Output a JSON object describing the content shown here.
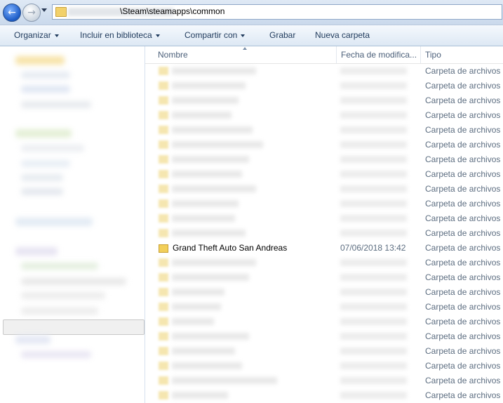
{
  "address": {
    "path": "\\Steam\\steamapps\\common",
    "back_icon": "arrow-left-icon",
    "forward_icon": "arrow-right-icon",
    "folder_icon": "folder-icon"
  },
  "toolbar": {
    "organize": "Organizar",
    "include_library": "Incluir en biblioteca",
    "share_with": "Compartir con",
    "burn": "Grabar",
    "new_folder": "Nueva carpeta"
  },
  "columns": {
    "name": "Nombre",
    "date": "Fecha de modifica...",
    "type": "Tipo"
  },
  "rows": [
    {
      "name": "",
      "date": "",
      "type": "Carpeta de archivos"
    },
    {
      "name": "",
      "date": "",
      "type": "Carpeta de archivos"
    },
    {
      "name": "",
      "date": "",
      "type": "Carpeta de archivos"
    },
    {
      "name": "",
      "date": "",
      "type": "Carpeta de archivos"
    },
    {
      "name": "",
      "date": "",
      "type": "Carpeta de archivos"
    },
    {
      "name": "",
      "date": "",
      "type": "Carpeta de archivos"
    },
    {
      "name": "",
      "date": "",
      "type": "Carpeta de archivos"
    },
    {
      "name": "",
      "date": "",
      "type": "Carpeta de archivos"
    },
    {
      "name": "",
      "date": "",
      "type": "Carpeta de archivos"
    },
    {
      "name": "",
      "date": "",
      "type": "Carpeta de archivos"
    },
    {
      "name": "",
      "date": "",
      "type": "Carpeta de archivos"
    },
    {
      "name": "",
      "date": "",
      "type": "Carpeta de archivos"
    },
    {
      "name": "Grand Theft Auto San Andreas",
      "date": "07/06/2018 13:42",
      "type": "Carpeta de archivos"
    },
    {
      "name": "",
      "date": "",
      "type": "Carpeta de archivos"
    },
    {
      "name": "",
      "date": "",
      "type": "Carpeta de archivos"
    },
    {
      "name": "",
      "date": "",
      "type": "Carpeta de archivos"
    },
    {
      "name": "",
      "date": "",
      "type": "Carpeta de archivos"
    },
    {
      "name": "",
      "date": "",
      "type": "Carpeta de archivos"
    },
    {
      "name": "",
      "date": "",
      "type": "Carpeta de archivos"
    },
    {
      "name": "",
      "date": "",
      "type": "Carpeta de archivos"
    },
    {
      "name": "",
      "date": "",
      "type": "Carpeta de archivos"
    },
    {
      "name": "",
      "date": "",
      "type": "Carpeta de archivos"
    },
    {
      "name": "",
      "date": "",
      "type": "Carpeta de archivos"
    },
    {
      "name": "",
      "date": "",
      "type": "Carpeta de archivos"
    }
  ]
}
